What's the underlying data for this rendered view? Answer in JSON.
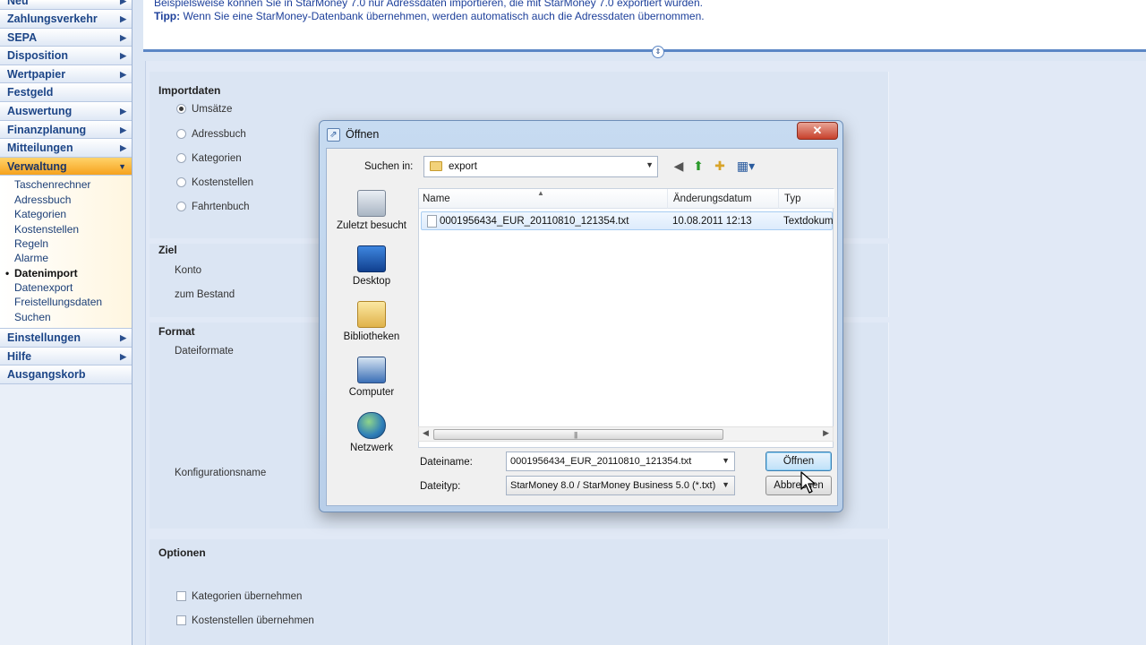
{
  "sidebar": {
    "items": [
      {
        "label": "Neu",
        "arrow": "▶"
      },
      {
        "label": "Zahlungsverkehr",
        "arrow": "▶"
      },
      {
        "label": "SEPA",
        "arrow": "▶"
      },
      {
        "label": "Disposition",
        "arrow": "▶"
      },
      {
        "label": "Wertpapier",
        "arrow": "▶"
      },
      {
        "label": "Festgeld",
        "arrow": ""
      },
      {
        "label": "Auswertung",
        "arrow": "▶"
      },
      {
        "label": "Finanzplanung",
        "arrow": "▶"
      },
      {
        "label": "Mitteilungen",
        "arrow": "▶"
      },
      {
        "label": "Verwaltung",
        "arrow": "▼"
      },
      {
        "label": "Einstellungen",
        "arrow": "▶"
      },
      {
        "label": "Hilfe",
        "arrow": "▶"
      },
      {
        "label": "Ausgangskorb",
        "arrow": ""
      }
    ],
    "sub_items": [
      "Taschenrechner",
      "Adressbuch",
      "Kategorien",
      "Kostenstellen",
      "Regeln",
      "Alarme",
      "Datenimport",
      "Datenexport",
      "Freistellungsdaten",
      "Suchen"
    ]
  },
  "info": {
    "line1": "Beispielsweise können Sie in StarMoney 7.0 nur Adressdaten importieren, die mit StarMoney 7.0 exportiert wurden.",
    "tip_label": "Tipp:",
    "tip_text": " Wenn Sie eine StarMoney-Datenbank übernehmen, werden automatisch auch die Adressdaten übernommen."
  },
  "form": {
    "importdaten_title": "Importdaten",
    "import_options": [
      "Umsätze",
      "Adressbuch",
      "Kategorien",
      "Kostenstellen",
      "Fahrtenbuch"
    ],
    "ziel_title": "Ziel",
    "ziel_fields": [
      "Konto",
      "zum Bestand"
    ],
    "format_title": "Format",
    "format_fields": [
      "Dateiformate",
      "Konfigurationsname"
    ],
    "optionen_title": "Optionen",
    "optionen_checks": [
      "Kategorien übernehmen",
      "Kostenstellen übernehmen"
    ]
  },
  "dialog": {
    "title": "Öffnen",
    "close": "✕",
    "lookin_label": "Suchen in:",
    "lookin_value": "export",
    "places": [
      "Zuletzt besucht",
      "Desktop",
      "Bibliotheken",
      "Computer",
      "Netzwerk"
    ],
    "columns": {
      "name": "Name",
      "date": "Änderungsdatum",
      "type": "Typ"
    },
    "file": {
      "name": "0001956434_EUR_20110810_121354.txt",
      "date": "10.08.2011 12:13",
      "type": "Textdokument"
    },
    "filename_label": "Dateiname:",
    "filename_value": "0001956434_EUR_20110810_121354.txt",
    "filetype_label": "Dateityp:",
    "filetype_value": "StarMoney 8.0 / StarMoney Business 5.0 (*.txt)",
    "open_button": "Öffnen",
    "cancel_button": "Abbrechen"
  },
  "colors": {
    "accent": "#5b86c5",
    "active_nav": "#f6a21d",
    "close": "#c7402b"
  }
}
